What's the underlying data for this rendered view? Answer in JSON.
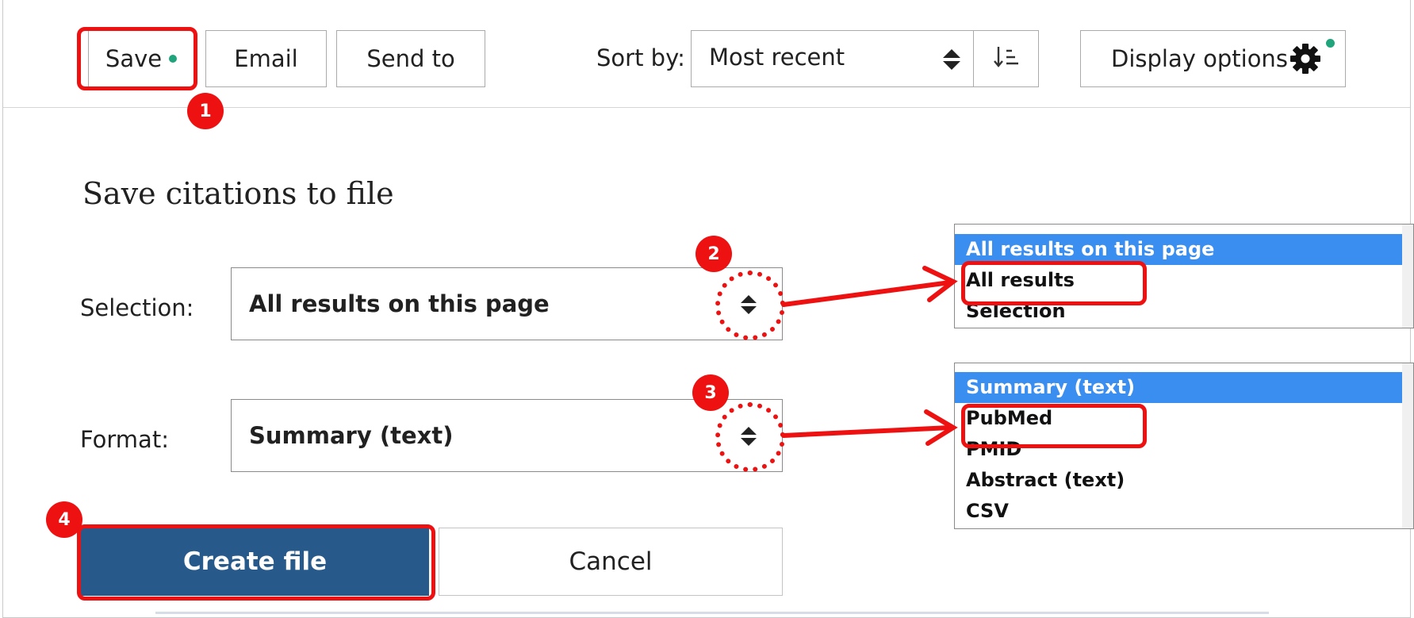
{
  "toolbar": {
    "save_label": "Save",
    "email_label": "Email",
    "send_to_label": "Send to",
    "sort_label": "Sort by:",
    "sort_value": "Most recent",
    "display_options_label": "Display options"
  },
  "dialog": {
    "title": "Save citations to file",
    "selection_label": "Selection:",
    "selection_value": "All results on this page",
    "format_label": "Format:",
    "format_value": "Summary (text)",
    "create_button": "Create file",
    "cancel_button": "Cancel"
  },
  "selection_dropdown": {
    "options": [
      "All results on this page",
      "All results",
      "Selection"
    ],
    "selected": "All results on this page"
  },
  "format_dropdown": {
    "options": [
      "Summary (text)",
      "PubMed",
      "PMID",
      "Abstract (text)",
      "CSV"
    ],
    "selected": "Summary (text)"
  },
  "annotations": {
    "steps": [
      "1",
      "2",
      "3",
      "4"
    ]
  },
  "colors": {
    "accent": "#275a8a",
    "highlight": "#ee1111",
    "status_dot": "#20a47b",
    "selected_option": "#3a8ef0"
  }
}
